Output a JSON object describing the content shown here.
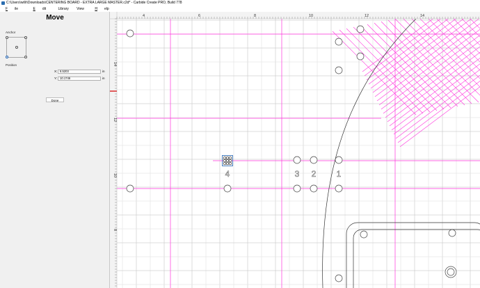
{
  "window": {
    "title": "C:\\Users\\willr\\Downloads\\CENTERING BOARD - EXTRA LARGE MASTER.c2d* - Carbide Create PRO, Build 778"
  },
  "menu": {
    "items": [
      {
        "label": "File",
        "mnemonic": "F",
        "rest": "ile"
      },
      {
        "label": "Edit",
        "mnemonic": "E",
        "rest": "dit"
      },
      {
        "label": "Library",
        "mnemonic": "",
        "rest": "Library"
      },
      {
        "label": "View",
        "mnemonic": "",
        "rest": "View"
      },
      {
        "label": "Help",
        "mnemonic": "H",
        "rest": "elp"
      }
    ]
  },
  "panel": {
    "title": "Move",
    "anchor_label": "Anchor",
    "anchor_selected": "bottom-left",
    "position_label": "Position",
    "x_label": "X:",
    "x_value": "6.5203",
    "y_label": "Y:",
    "y_value": "10.1746",
    "unit": "in",
    "done_label": "Done"
  },
  "canvas": {
    "top_ruler_labels": [
      "4",
      "6",
      "8",
      "10",
      "12",
      "14"
    ],
    "left_ruler_labels": [
      "14",
      "12",
      "10",
      "8"
    ],
    "hole_labels": [
      "4",
      "3",
      "2",
      "1"
    ],
    "colors": {
      "guide": "#ff33dd",
      "grid": "#d6d6d6",
      "grid_major": "#b8b8b8",
      "ruler_bg": "#f3f3f3",
      "origin_marker": "#d81b1b",
      "selection": "#1b5fb0"
    }
  }
}
